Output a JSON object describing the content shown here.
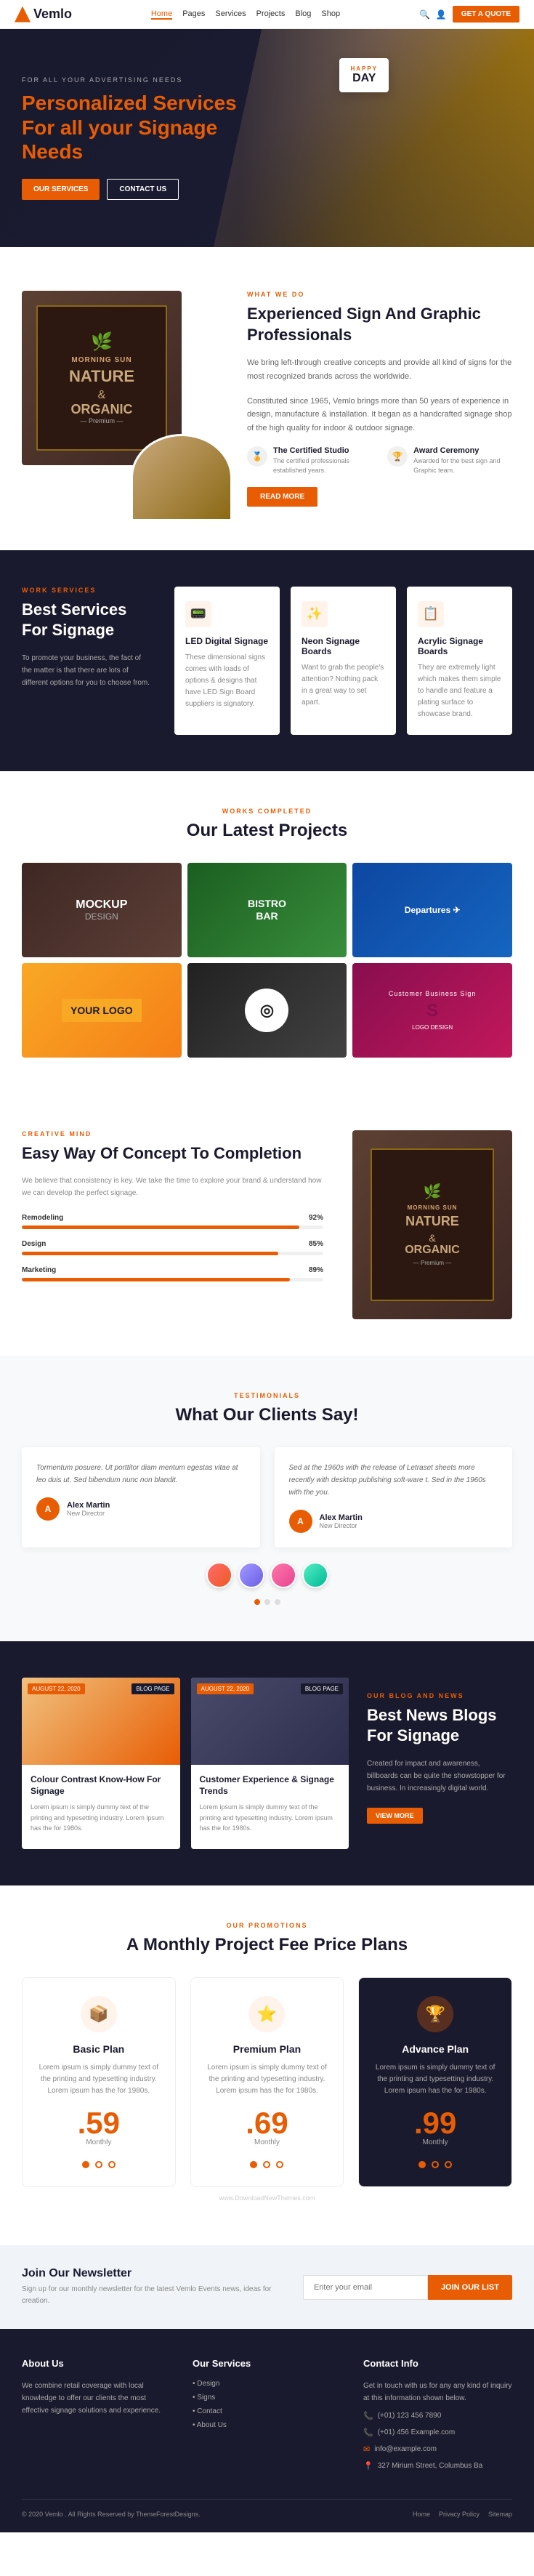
{
  "navbar": {
    "logo": "Vemlo",
    "links": [
      {
        "label": "Home",
        "active": true
      },
      {
        "label": "Pages",
        "active": false
      },
      {
        "label": "Services",
        "active": false
      },
      {
        "label": "Projects",
        "active": false
      },
      {
        "label": "Blog",
        "active": false
      },
      {
        "label": "Shop",
        "active": false
      }
    ],
    "quote_button": "GET A QUOTE"
  },
  "hero": {
    "pre_text": "FOR ALL YOUR ADVERTISING NEEDS",
    "headline_1": "Personalized Services",
    "headline_2": "For all your",
    "headline_highlight": "Signage",
    "headline_3": "Needs",
    "btn_our_services": "OUR SERVICES",
    "btn_contact": "CONTACT US",
    "day_card_happy": "HAPPY",
    "day_card_day": "DAY"
  },
  "about": {
    "pre_label": "WHAT WE DO",
    "heading": "Experienced Sign And Graphic Professionals",
    "description": "We bring left-through creative concepts and provide all kind of signs for the most recognized brands across the worldwide.",
    "description_2": "Constituted since 1965, Vemlo brings more than 50 years of experience in design, manufacture & installation. It began as a handcrafted signage shop of the high quality for indoor & outdoor signage.",
    "badge_1_title": "The Certified Studio",
    "badge_1_desc": "The certified professionals established years.",
    "badge_2_title": "Award Ceremony",
    "badge_2_desc": "Awarded for the best sign and Graphic team.",
    "btn_read_more": "READ MORE",
    "brand_nature": "NATURE",
    "brand_and": "&",
    "brand_organic": "ORGANIC"
  },
  "services": {
    "pre_label": "WORK SERVICES",
    "heading": "Best Services For Signage",
    "description": "To promote your business, the fact of the matter is that there are lots of different options for you to choose from.",
    "items": [
      {
        "icon": "📟",
        "title": "LED Digital Signage",
        "description": "These dimensional signs comes with loads of options & designs that have LED Sign Board suppliers is signatory."
      },
      {
        "icon": "✨",
        "title": "Neon Signage Boards",
        "description": "Want to grab the people's attention? Nothing pack in a great way to set apart."
      },
      {
        "icon": "📋",
        "title": "Acrylic Signage Boards",
        "description": "They are extremely light which makes them simple to handle and feature a plating surface to showcase brand."
      }
    ]
  },
  "projects": {
    "pre_label": "WORKS COMPLETED",
    "heading": "Our Latest Projects",
    "items": [
      {
        "label": "MOCKUP DESIGN",
        "color": "proj1"
      },
      {
        "label": "BISTRO BAR",
        "color": "proj2"
      },
      {
        "label": "DEPARTURES",
        "color": "proj3"
      },
      {
        "label": "YOUR LOGO",
        "color": "proj4"
      },
      {
        "label": "CIRCLE LOGO",
        "color": "proj5"
      },
      {
        "label": "S LOGO",
        "color": "proj6"
      }
    ]
  },
  "concept": {
    "pre_label": "CREATIVE MIND",
    "heading": "Easy Way Of Concept To Completion",
    "description": "We believe that consistency is key. We take the time to explore your brand & understand how we can develop the perfect signage.",
    "progress": [
      {
        "label": "Remodeling",
        "value": 92
      },
      {
        "label": "Design",
        "value": 85
      },
      {
        "label": "Marketing",
        "value": 89
      }
    ],
    "brand_nature": "NATURE",
    "brand_and": "&",
    "brand_organic": "ORGANIC"
  },
  "testimonials": {
    "pre_label": "TESTIMONIALS",
    "heading": "What Our Clients Say!",
    "items": [
      {
        "text": "Tormentum posuere. Ut porttitor diam mentum egestas vitae at leo duis ut. Sed bibendum nunc non blandit.",
        "author_name": "Alex Martin",
        "author_role": "New Director"
      },
      {
        "text": "Sed at the 1960s with the release of Letraset sheets more recently with desktop publishing soft-ware t. Sed in the 1960s with the you.",
        "author_name": "Alex Martin",
        "author_role": "New Director"
      }
    ]
  },
  "blog": {
    "pre_label": "OUR BLOG AND NEWS",
    "heading": "Best News Blogs For Signage",
    "description": "Created for impact and awareness, billboards can be quite the showstopper for business. In increasingly digital world.",
    "btn_view_more": "VIEW MORE",
    "posts": [
      {
        "date": "AUGUST 22, 2020",
        "tag": "BLOG PAGE",
        "title": "Colour Contrast Know-How For Signage",
        "description": "Lorem ipsum is simply dummy text of the printing and typesetting industry. Lorem ipsum has the for 1980s.",
        "img_color": "blog-img-1"
      },
      {
        "date": "AUGUST 22, 2020",
        "tag": "BLOG PAGE",
        "title": "Customer Experience & Signage Trends",
        "description": "Lorem ipsum is simply dummy text of the printing and typesetting industry. Lorem ipsum has the for 1980s.",
        "img_color": "blog-img-2"
      }
    ]
  },
  "pricing": {
    "pre_label": "OUR PROMOTIONS",
    "heading": "A Monthly Project Fee Price Plans",
    "plans": [
      {
        "icon": "📦",
        "name": "Basic Plan",
        "description": "Lorem ipsum is simply dummy text of the printing and typesetting industry. Lorem ipsum has the for 1980s.",
        "price": ".59",
        "period": "Monthly",
        "featured": false
      },
      {
        "icon": "⭐",
        "name": "Premium Plan",
        "description": "Lorem ipsum is simply dummy text of the printing and typesetting industry. Lorem ipsum has the for 1980s.",
        "price": ".69",
        "period": "Monthly",
        "featured": false
      },
      {
        "icon": "🏆",
        "name": "Advance Plan",
        "description": "Lorem ipsum is simply dummy text of the printing and typesetting industry. Lorem ipsum has the for 1980s.",
        "price": ".99",
        "period": "Monthly",
        "featured": true
      }
    ],
    "watermark": "www.DownloadNewThemes.com"
  },
  "newsletter": {
    "heading": "Join Our Newsletter",
    "description": "Sign up for our monthly newsletter for the latest Vemlo Events news, ideas for creation.",
    "input_placeholder": "Enter your email",
    "btn_label": "JOIN OUR LIST"
  },
  "footer": {
    "about_title": "About Us",
    "about_text": "We combine retail coverage with local knowledge to offer our clients the most effective signage solutions and experience.",
    "services_title": "Our Services",
    "services_links": [
      "• Design",
      "• Signs",
      "• Contact",
      "• About Us"
    ],
    "contact_title": "Contact Info",
    "contact_note": "Get in touch with us for any any kind of inquiry at this information shown below.",
    "phone_1": "(+01) 123 456 7890",
    "phone_2": "(+01) 456 Example.com",
    "email": "info@example.com",
    "address": "327 Mirium Street, Columbus Ba",
    "copyright": "© 2020 Vemlo . All Rights Reserved by ThemeForestDesigns.",
    "footer_links": [
      "Home",
      "Privacy Policy",
      "Sitemap"
    ]
  }
}
